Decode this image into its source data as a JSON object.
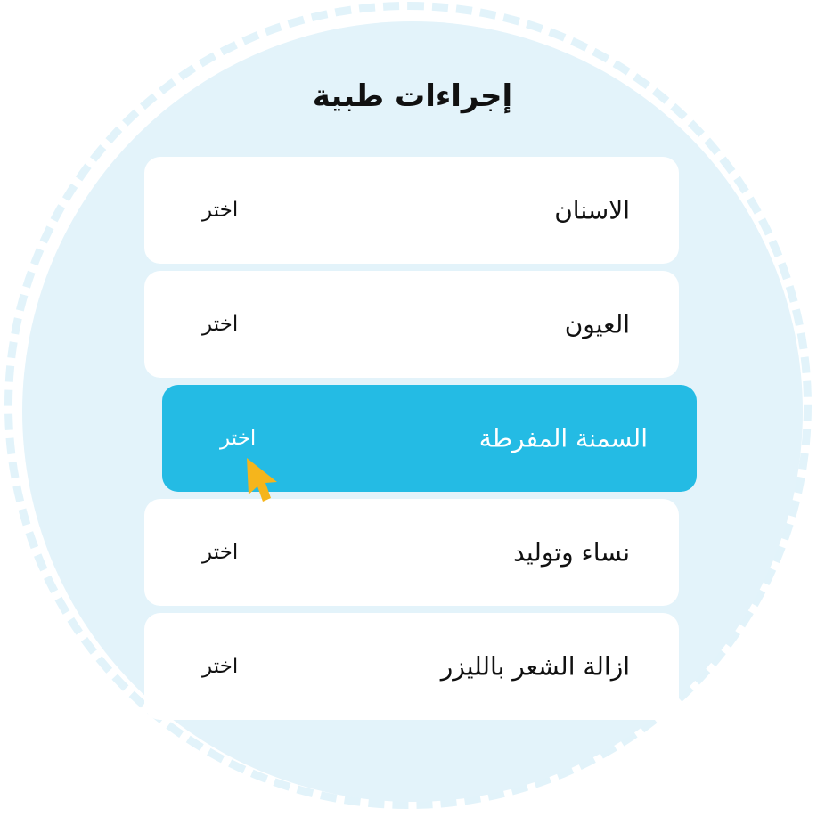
{
  "title": "إجراءات طبية",
  "items": [
    {
      "label": "الاسنان",
      "action": "اختر",
      "selected": false
    },
    {
      "label": "العيون",
      "action": "اختر",
      "selected": false
    },
    {
      "label": "السمنة المفرطة",
      "action": "اختر",
      "selected": true
    },
    {
      "label": "نساء وتوليد",
      "action": "اختر",
      "selected": false
    },
    {
      "label": "ازالة الشعر بالليزر",
      "action": "اختر",
      "selected": false
    }
  ],
  "colors": {
    "accent": "#24bbe4",
    "circle_bg": "#e3f3fa",
    "cursor": "#f5b51c"
  },
  "icons": {
    "cursor": "mouse-pointer-icon"
  }
}
